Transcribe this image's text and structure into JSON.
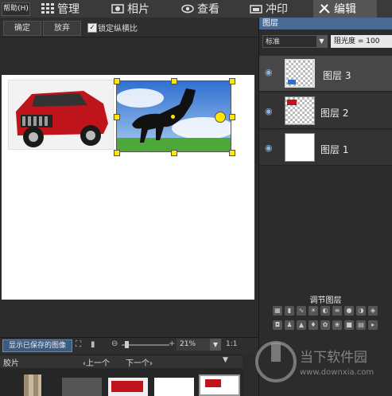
{
  "menu": {
    "help": "帮助(H)",
    "tabs": [
      {
        "label": "管理",
        "icon": "grid-icon"
      },
      {
        "label": "相片",
        "icon": "photo-icon"
      },
      {
        "label": "查看",
        "icon": "eye-icon"
      },
      {
        "label": "冲印",
        "icon": "print-icon"
      },
      {
        "label": "编辑",
        "icon": "tools-icon"
      }
    ]
  },
  "toolbar": {
    "confirm": "确定",
    "discard": "放弃",
    "lock_ratio_label": "锁定纵横比",
    "lock_ratio_checked": true
  },
  "status": {
    "show_saved": "显示已保存的图像",
    "zoom": "21%",
    "ratio": "1:1"
  },
  "film": {
    "title": "胶片",
    "prev": "上一个",
    "next": "下一个"
  },
  "layers": {
    "title": "图层",
    "blend_mode": "标准",
    "opacity_label": "阻光度 = 100",
    "items": [
      {
        "name": "图层 3",
        "selected": true
      },
      {
        "name": "图层 2",
        "selected": false
      },
      {
        "name": "图层 1",
        "selected": false
      }
    ],
    "adjust_title": "调节图层"
  },
  "watermark": {
    "name": "当下软件园",
    "url": "www.downxia.com"
  }
}
